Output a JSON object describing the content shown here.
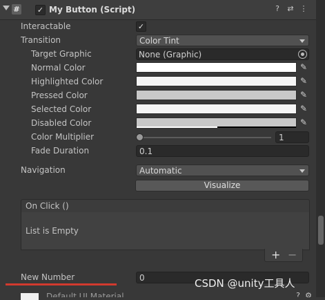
{
  "header": {
    "title": "My Button (Script)",
    "enabled": true,
    "script_icon": "#",
    "icons": [
      "help-icon",
      "presets-icon",
      "more-icon"
    ]
  },
  "fields": {
    "interactable": {
      "label": "Interactable",
      "checked": true,
      "check": "✓"
    },
    "transition": {
      "label": "Transition",
      "value": "Color Tint"
    },
    "target_graphic": {
      "label": "Target Graphic",
      "value": "None (Graphic)"
    },
    "normal_color": {
      "label": "Normal Color",
      "color": "#ffffff"
    },
    "highlighted_color": {
      "label": "Highlighted Color",
      "color": "#f5f5f5"
    },
    "pressed_color": {
      "label": "Pressed Color",
      "color": "#c8c8c8"
    },
    "selected_color": {
      "label": "Selected Color",
      "color": "#f5f5f5"
    },
    "disabled_color": {
      "label": "Disabled Color",
      "color": "#c8c8c8",
      "alpha_fraction": 0.5
    },
    "color_multiplier": {
      "label": "Color Multiplier",
      "value": "1",
      "slider_fraction": 0.0
    },
    "fade_duration": {
      "label": "Fade Duration",
      "value": "0.1"
    },
    "navigation": {
      "label": "Navigation",
      "value": "Automatic"
    },
    "visualize_button": "Visualize",
    "on_click": {
      "header": "On Click ()",
      "empty_text": "List is Empty",
      "add": "+",
      "remove": "−"
    },
    "new_number": {
      "label": "New Number",
      "value": "0"
    },
    "next_component": "Default UI Material"
  },
  "watermark": "CSDN @unity工具人"
}
